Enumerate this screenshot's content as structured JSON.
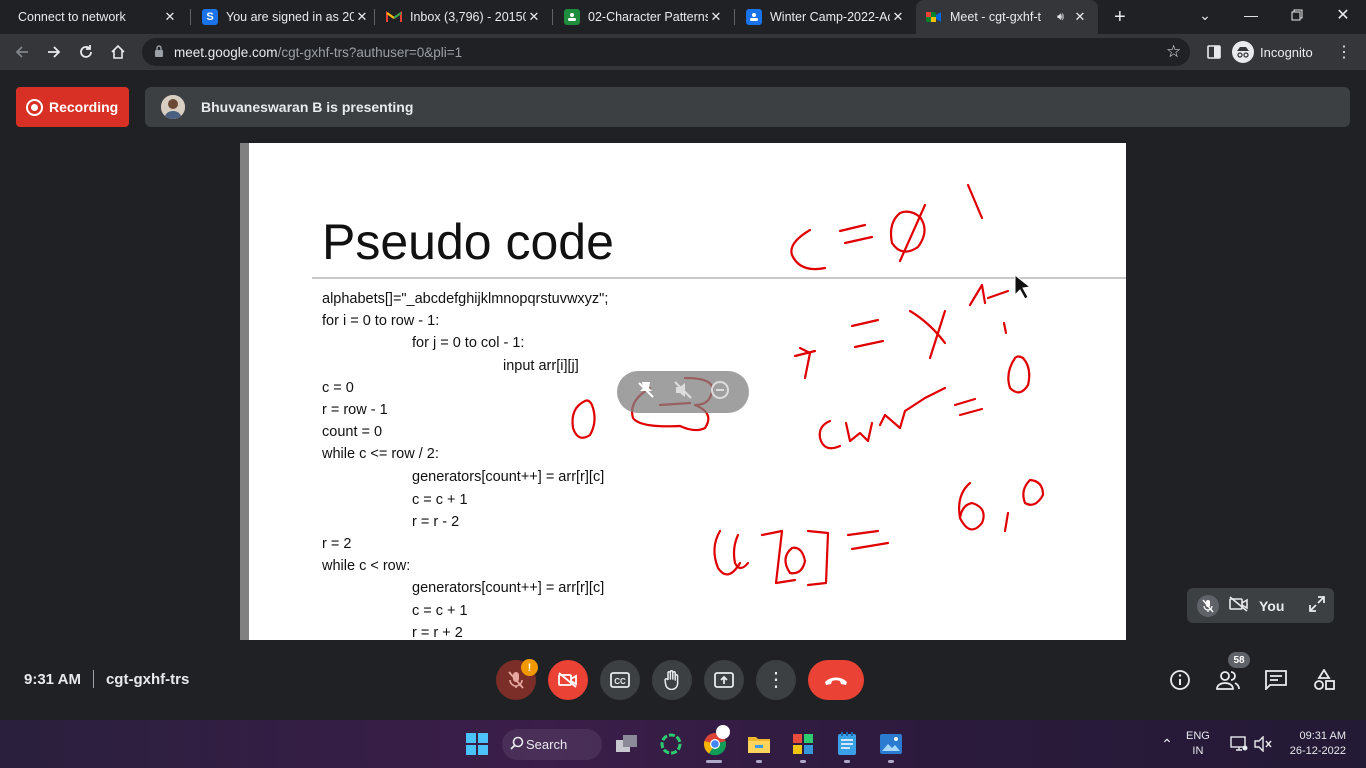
{
  "browser": {
    "tabs": [
      {
        "title": "Connect to network",
        "icon": "none"
      },
      {
        "title": "You are signed in as 20",
        "icon": "s-logo-icon"
      },
      {
        "title": "Inbox (3,796) - 20150",
        "icon": "gmail-icon"
      },
      {
        "title": "02-Character Patterns",
        "icon": "classroom-icon"
      },
      {
        "title": "Winter Camp-2022-Ac",
        "icon": "classroom-icon"
      },
      {
        "title": "Meet - cgt-gxhf-t",
        "icon": "meet-icon",
        "active": true
      }
    ],
    "new_tab_label": "+",
    "url_main": "meet.google.com",
    "url_rest": "/cgt-gxhf-trs?authuser=0&pli=1",
    "profile_label": "Incognito"
  },
  "meet": {
    "recording_label": "Recording",
    "presenting_text": "Bhuvaneswaran B is presenting",
    "slide": {
      "title": "Pseudo code",
      "code_lines": [
        "alphabets[]=\"_abcdefghijklmnopqrstuvwxyz\";",
        "for i = 0 to row - 1:",
        "for j = 0 to col - 1:",
        "input arr[i][j]",
        "c = 0",
        "r = row - 1",
        "count = 0",
        "while c <= row / 2:",
        "generators[count++] = arr[r][c]",
        "c = c + 1",
        "r = r - 2",
        "r = 2",
        "while c < row:",
        "generators[count++] = arr[r][c]",
        "c = c + 1",
        "r = r + 2"
      ]
    },
    "self_tile_label": "You",
    "time": "9:31 AM",
    "meeting_code": "cgt-gxhf-trs",
    "participants_count": "58",
    "mic_alert": "!"
  },
  "taskbar": {
    "search_label": "Search",
    "lang_top": "ENG",
    "lang_bottom": "IN",
    "clock_time": "09:31 AM",
    "clock_date": "26-12-2022"
  },
  "colors": {
    "recording": "#d93025",
    "end_call": "#ea4335",
    "ink": "#e00000",
    "meet_bg": "#202124"
  }
}
